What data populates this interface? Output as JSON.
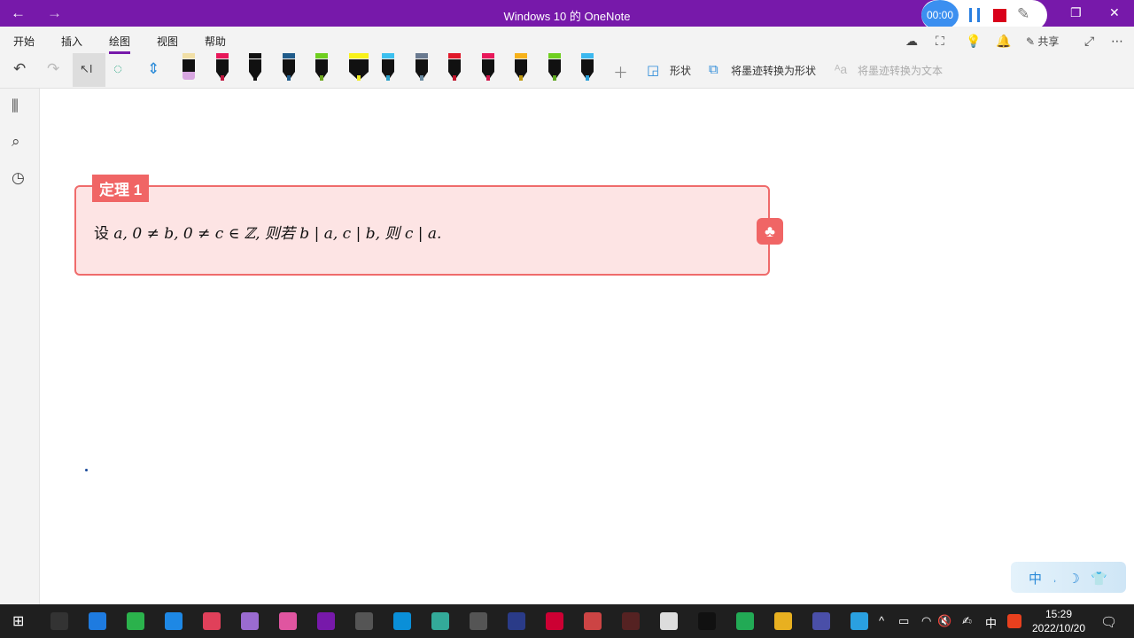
{
  "window": {
    "title": "Windows 10 的 OneNote"
  },
  "recorder": {
    "timer": "00:00"
  },
  "menu": {
    "tabs": [
      "开始",
      "插入",
      "绘图",
      "视图",
      "帮助"
    ],
    "active": "绘图",
    "share": "共享"
  },
  "toolbar": {
    "shapes": "形状",
    "ink_to_shape": "将墨迹转换为形状",
    "ink_to_text": "将墨迹转换为文本"
  },
  "pens": [
    {
      "cap": "#f1dfa6",
      "body": "#111",
      "tip": "#d7a6e0",
      "type": "eraser"
    },
    {
      "cap": "#e8185a",
      "body": "#111",
      "tip": "#c0163f"
    },
    {
      "cap": "#111",
      "body": "#111",
      "tip": "#111"
    },
    {
      "cap": "#1f5b8a",
      "body": "#111",
      "tip": "#1f5b8a"
    },
    {
      "cap": "#6fcf1f",
      "body": "#111",
      "tip": "#6fa820"
    },
    {
      "cap": "#f8f21a",
      "body": "#111",
      "tip": "#f0ec20",
      "type": "highlighter"
    },
    {
      "cap": "#3cc0ef",
      "body": "#111",
      "tip": "#2aa0c8"
    },
    {
      "cap": "#6a7a90",
      "body": "#111",
      "tip": "#6a8aa0"
    },
    {
      "cap": "#e0192a",
      "body": "#111",
      "tip": "#c0142a"
    },
    {
      "cap": "#e8185a",
      "body": "#111",
      "tip": "#d0164a"
    },
    {
      "cap": "#f7b21a",
      "body": "#111",
      "tip": "#c09a10"
    },
    {
      "cap": "#6fcf1f",
      "body": "#111",
      "tip": "#5fa820"
    },
    {
      "cap": "#3cb8ef",
      "body": "#111",
      "tip": "#2aa0d8"
    }
  ],
  "theorem": {
    "label": "定理 1",
    "text_prefix": "设 ",
    "math": "a, 0 ≠ b, 0 ≠ c ∈ ℤ, 则若 b | a, c | b, 则 c | a."
  },
  "ime": {
    "text": "中 ˒ ☽ 👕"
  },
  "taskbar": {
    "time": "15:29",
    "date": "2022/10/20",
    "tray_ime": "中"
  },
  "colors": {
    "accent": "#7719aa",
    "theorem_border": "#ef6b6b",
    "theorem_bg": "#fde4e4"
  }
}
